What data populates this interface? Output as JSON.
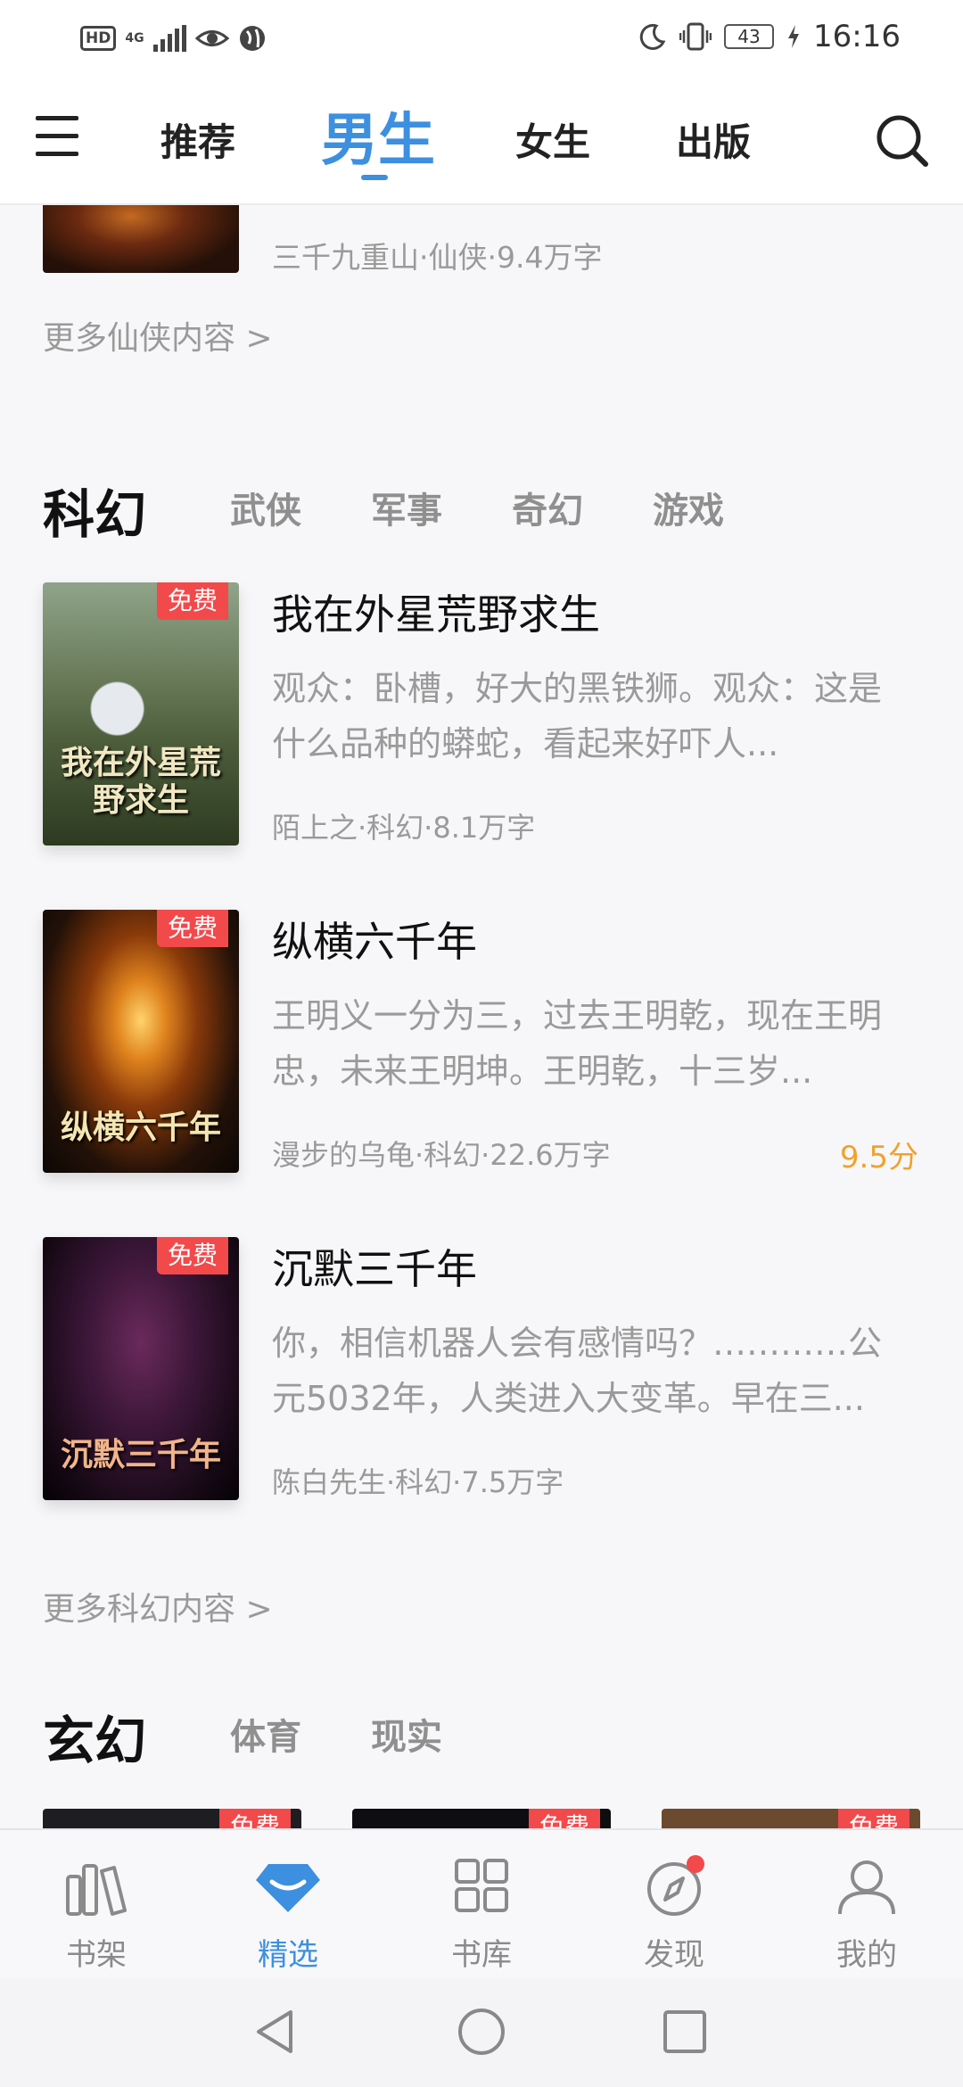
{
  "status_bar": {
    "hd": "HD",
    "network": "4G",
    "battery": "43",
    "time": "16:16"
  },
  "top_tabs": [
    "推荐",
    "男生",
    "女生",
    "出版"
  ],
  "active_top_tab": "男生",
  "partial_book": {
    "meta": "三千九重山·仙侠·9.4万字"
  },
  "more_xianxia": "更多仙侠内容 >",
  "scifi_section": {
    "title": "科幻",
    "sub_tabs": [
      "武侠",
      "军事",
      "奇幻",
      "游戏"
    ]
  },
  "books": [
    {
      "badge": "免费",
      "cover_text": "我在外星荒野求生",
      "title": "我在外星荒野求生",
      "desc": "观众：卧槽，好大的黑铁狮。观众：这是什么品种的蟒蛇，看起来好吓人...",
      "meta": "陌上之·科幻·8.1万字",
      "score": ""
    },
    {
      "badge": "免费",
      "cover_text": "纵横六千年",
      "title": "纵横六千年",
      "desc": "王明义一分为三，过去王明乾，现在王明忠，未来王明坤。王明乾，十三岁...",
      "meta": "漫步的乌龟·科幻·22.6万字",
      "score": "9.5分"
    },
    {
      "badge": "免费",
      "cover_text": "沉默三千年",
      "title": "沉默三千年",
      "desc": "你，相信机器人会有感情吗？…………公元5032年，人类进入大变革。早在三...",
      "meta": "陈白先生·科幻·7.5万字",
      "score": ""
    }
  ],
  "more_scifi": "更多科幻内容 >",
  "xuanhuan_section": {
    "title": "玄幻",
    "sub_tabs": [
      "体育",
      "现实"
    ]
  },
  "thumb_badges": [
    "免费",
    "免费",
    "免费"
  ],
  "bottom_nav": [
    "书架",
    "精选",
    "书库",
    "发现",
    "我的"
  ],
  "colors": {
    "accent": "#3d8fe0",
    "badge": "#f2494b",
    "score": "#f0a22a",
    "muted_text": "#9a9a9a"
  }
}
